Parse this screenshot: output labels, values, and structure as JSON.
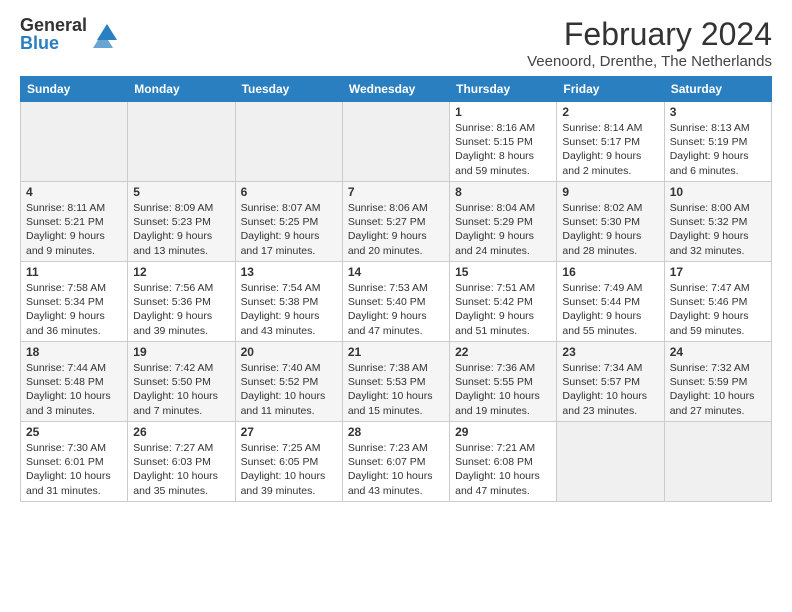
{
  "logo": {
    "line1": "General",
    "line2": "Blue"
  },
  "title": "February 2024",
  "subtitle": "Veenoord, Drenthe, The Netherlands",
  "days_of_week": [
    "Sunday",
    "Monday",
    "Tuesday",
    "Wednesday",
    "Thursday",
    "Friday",
    "Saturday"
  ],
  "weeks": [
    [
      {
        "num": "",
        "info": ""
      },
      {
        "num": "",
        "info": ""
      },
      {
        "num": "",
        "info": ""
      },
      {
        "num": "",
        "info": ""
      },
      {
        "num": "1",
        "info": "Sunrise: 8:16 AM\nSunset: 5:15 PM\nDaylight: 8 hours and 59 minutes."
      },
      {
        "num": "2",
        "info": "Sunrise: 8:14 AM\nSunset: 5:17 PM\nDaylight: 9 hours and 2 minutes."
      },
      {
        "num": "3",
        "info": "Sunrise: 8:13 AM\nSunset: 5:19 PM\nDaylight: 9 hours and 6 minutes."
      }
    ],
    [
      {
        "num": "4",
        "info": "Sunrise: 8:11 AM\nSunset: 5:21 PM\nDaylight: 9 hours and 9 minutes."
      },
      {
        "num": "5",
        "info": "Sunrise: 8:09 AM\nSunset: 5:23 PM\nDaylight: 9 hours and 13 minutes."
      },
      {
        "num": "6",
        "info": "Sunrise: 8:07 AM\nSunset: 5:25 PM\nDaylight: 9 hours and 17 minutes."
      },
      {
        "num": "7",
        "info": "Sunrise: 8:06 AM\nSunset: 5:27 PM\nDaylight: 9 hours and 20 minutes."
      },
      {
        "num": "8",
        "info": "Sunrise: 8:04 AM\nSunset: 5:29 PM\nDaylight: 9 hours and 24 minutes."
      },
      {
        "num": "9",
        "info": "Sunrise: 8:02 AM\nSunset: 5:30 PM\nDaylight: 9 hours and 28 minutes."
      },
      {
        "num": "10",
        "info": "Sunrise: 8:00 AM\nSunset: 5:32 PM\nDaylight: 9 hours and 32 minutes."
      }
    ],
    [
      {
        "num": "11",
        "info": "Sunrise: 7:58 AM\nSunset: 5:34 PM\nDaylight: 9 hours and 36 minutes."
      },
      {
        "num": "12",
        "info": "Sunrise: 7:56 AM\nSunset: 5:36 PM\nDaylight: 9 hours and 39 minutes."
      },
      {
        "num": "13",
        "info": "Sunrise: 7:54 AM\nSunset: 5:38 PM\nDaylight: 9 hours and 43 minutes."
      },
      {
        "num": "14",
        "info": "Sunrise: 7:53 AM\nSunset: 5:40 PM\nDaylight: 9 hours and 47 minutes."
      },
      {
        "num": "15",
        "info": "Sunrise: 7:51 AM\nSunset: 5:42 PM\nDaylight: 9 hours and 51 minutes."
      },
      {
        "num": "16",
        "info": "Sunrise: 7:49 AM\nSunset: 5:44 PM\nDaylight: 9 hours and 55 minutes."
      },
      {
        "num": "17",
        "info": "Sunrise: 7:47 AM\nSunset: 5:46 PM\nDaylight: 9 hours and 59 minutes."
      }
    ],
    [
      {
        "num": "18",
        "info": "Sunrise: 7:44 AM\nSunset: 5:48 PM\nDaylight: 10 hours and 3 minutes."
      },
      {
        "num": "19",
        "info": "Sunrise: 7:42 AM\nSunset: 5:50 PM\nDaylight: 10 hours and 7 minutes."
      },
      {
        "num": "20",
        "info": "Sunrise: 7:40 AM\nSunset: 5:52 PM\nDaylight: 10 hours and 11 minutes."
      },
      {
        "num": "21",
        "info": "Sunrise: 7:38 AM\nSunset: 5:53 PM\nDaylight: 10 hours and 15 minutes."
      },
      {
        "num": "22",
        "info": "Sunrise: 7:36 AM\nSunset: 5:55 PM\nDaylight: 10 hours and 19 minutes."
      },
      {
        "num": "23",
        "info": "Sunrise: 7:34 AM\nSunset: 5:57 PM\nDaylight: 10 hours and 23 minutes."
      },
      {
        "num": "24",
        "info": "Sunrise: 7:32 AM\nSunset: 5:59 PM\nDaylight: 10 hours and 27 minutes."
      }
    ],
    [
      {
        "num": "25",
        "info": "Sunrise: 7:30 AM\nSunset: 6:01 PM\nDaylight: 10 hours and 31 minutes."
      },
      {
        "num": "26",
        "info": "Sunrise: 7:27 AM\nSunset: 6:03 PM\nDaylight: 10 hours and 35 minutes."
      },
      {
        "num": "27",
        "info": "Sunrise: 7:25 AM\nSunset: 6:05 PM\nDaylight: 10 hours and 39 minutes."
      },
      {
        "num": "28",
        "info": "Sunrise: 7:23 AM\nSunset: 6:07 PM\nDaylight: 10 hours and 43 minutes."
      },
      {
        "num": "29",
        "info": "Sunrise: 7:21 AM\nSunset: 6:08 PM\nDaylight: 10 hours and 47 minutes."
      },
      {
        "num": "",
        "info": ""
      },
      {
        "num": "",
        "info": ""
      }
    ]
  ]
}
